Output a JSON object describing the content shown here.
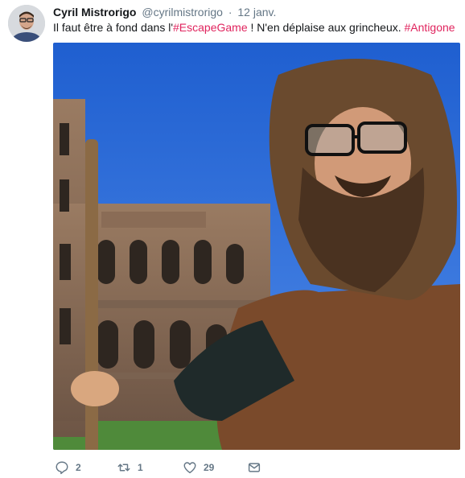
{
  "tweet": {
    "author_name": "Cyril Mistrorigo",
    "handle": "@cyrilmistrorigo",
    "separator": "·",
    "date": "12 janv.",
    "text_part1": "Il faut être à fond dans l'",
    "hashtag1": "#EscapeGame",
    "text_part2": " ! N'en déplaise aux grincheux. ",
    "hashtag2": "#Antigone"
  },
  "actions": {
    "replies": "2",
    "retweets": "1",
    "likes": "29"
  },
  "icons": {
    "reply": "reply-icon",
    "retweet": "retweet-icon",
    "like": "heart-icon",
    "dm": "mail-icon"
  },
  "colors": {
    "hashtag": "#e0245e",
    "meta": "#657786",
    "text": "#14171a"
  }
}
